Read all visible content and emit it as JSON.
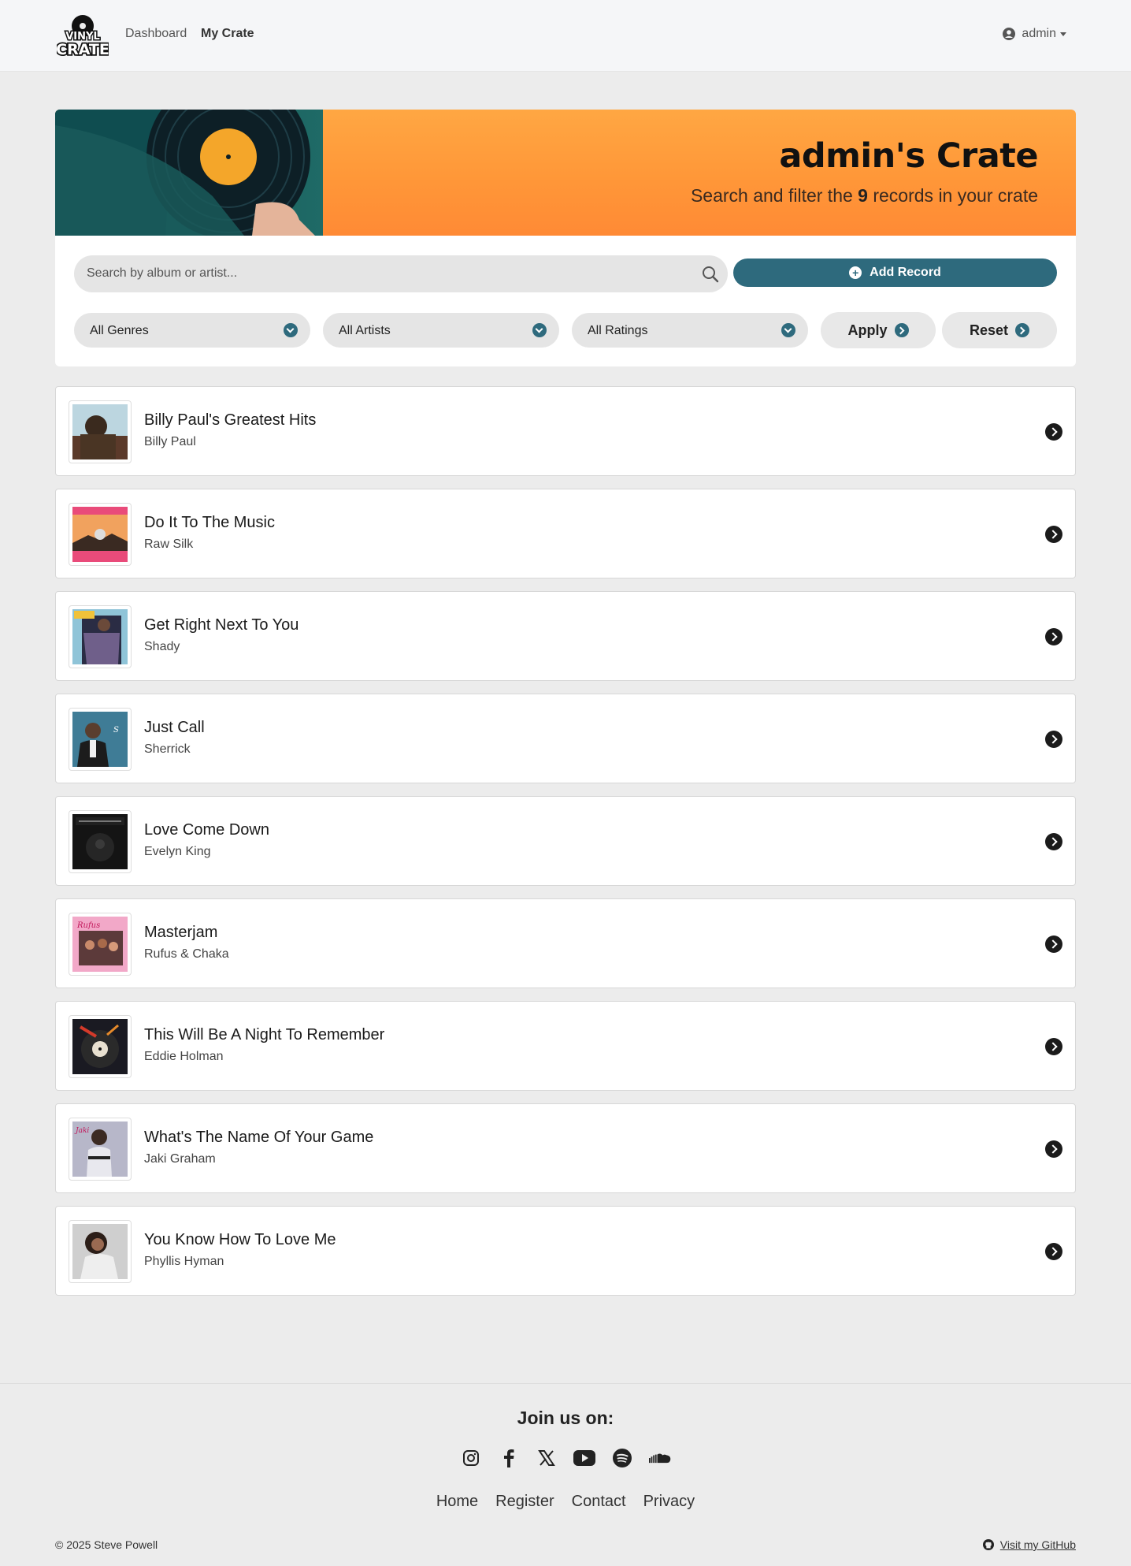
{
  "navbar": {
    "logo_text_top": "VINYL",
    "logo_text_bottom": "CRATE",
    "links": [
      {
        "label": "Dashboard"
      },
      {
        "label": "My Crate",
        "active": true
      }
    ],
    "user": {
      "label": "admin",
      "icon": "user-circle-icon"
    }
  },
  "hero": {
    "title": "admin's Crate",
    "subtitle_prefix": "Search and filter the ",
    "record_count": "9",
    "subtitle_suffix": " records in your crate",
    "colors": {
      "gradient_top": "#ffa743",
      "gradient_bottom": "#ff8a35"
    }
  },
  "filters": {
    "search_placeholder": "Search by album or artist...",
    "add_label": "Add Record",
    "genre_selected": "All Genres",
    "artist_selected": "All Artists",
    "rating_selected": "All Ratings",
    "apply_label": "Apply",
    "reset_label": "Reset",
    "accent": "#2e6a7d"
  },
  "records": [
    {
      "title": "Billy Paul's Greatest Hits",
      "artist": "Billy Paul"
    },
    {
      "title": "Do It To The Music",
      "artist": "Raw Silk"
    },
    {
      "title": "Get Right Next To You",
      "artist": "Shady"
    },
    {
      "title": "Just Call",
      "artist": "Sherrick"
    },
    {
      "title": "Love Come Down",
      "artist": "Evelyn King"
    },
    {
      "title": "Masterjam",
      "artist": "Rufus & Chaka"
    },
    {
      "title": "This Will Be A Night To Remember",
      "artist": "Eddie Holman"
    },
    {
      "title": "What's The Name Of Your Game",
      "artist": "Jaki Graham"
    },
    {
      "title": "You Know How To Love Me",
      "artist": "Phyllis Hyman"
    }
  ],
  "footer": {
    "join": "Join us on:",
    "socials": [
      "instagram-icon",
      "facebook-icon",
      "x-icon",
      "youtube-icon",
      "spotify-icon",
      "soundcloud-icon"
    ],
    "links": [
      "Home",
      "Register",
      "Contact",
      "Privacy"
    ],
    "copyright": "© 2025 Steve Powell",
    "github": "Visit my GitHub"
  }
}
